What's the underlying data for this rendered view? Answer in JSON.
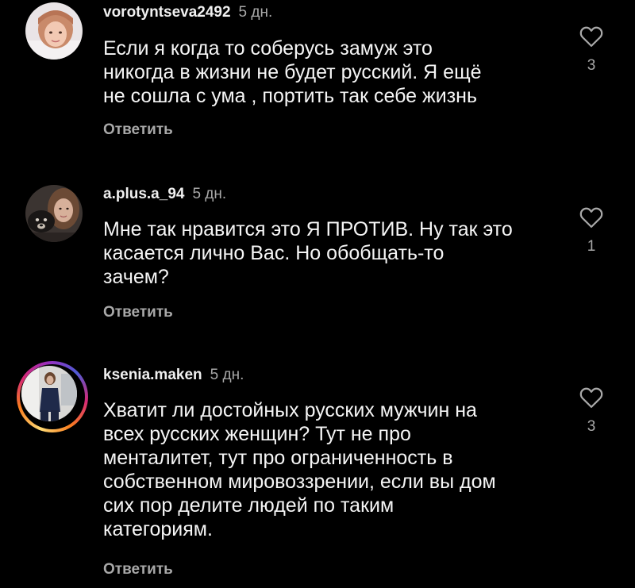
{
  "colors": {
    "background": "#000000",
    "text": "#f5f5f5",
    "secondary_text": "#a8a8a8",
    "story_ring": [
      "#feda75",
      "#fa7e1e",
      "#d62976",
      "#962fbf",
      "#4f5bd5"
    ]
  },
  "comments": [
    {
      "username": "vorotyntseva2492",
      "time": "5 дн.",
      "text_lines": [
        "Если я когда то соберусь замуж это",
        "никогда в жизни не будет русский. Я ещё",
        "не сошла с ума , портить так себе жизнь"
      ],
      "reply_label": "Ответить",
      "likes": "3",
      "like_icon": "heart-outline-icon",
      "has_story": false
    },
    {
      "username": "a.plus.a_94",
      "time": "5 дн.",
      "text_lines": [
        "Мне так нравится это Я ПРОТИВ. Ну так это",
        "касается лично Вас. Но обобщать-то",
        "зачем?"
      ],
      "reply_label": "Ответить",
      "likes": "1",
      "like_icon": "heart-outline-icon",
      "has_story": false
    },
    {
      "username": "ksenia.maken",
      "time": "5 дн.",
      "text_lines": [
        "Хватит ли достойных русских мужчин на",
        "всех русских женщин? Тут не про",
        "менталитет, тут про ограниченность в",
        "собственном мировоззрении, если вы дом",
        "сих пор делите людей по таким",
        "категориям."
      ],
      "reply_label": "Ответить",
      "likes": "3",
      "like_icon": "heart-outline-icon",
      "has_story": true
    }
  ]
}
